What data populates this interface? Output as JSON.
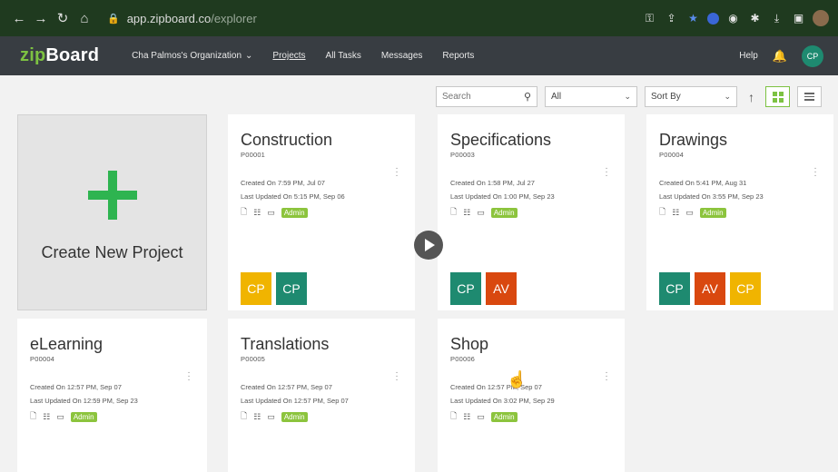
{
  "browser": {
    "url_host": "app.zipboard.co",
    "url_path": "/explorer"
  },
  "app": {
    "logo_zip": "zip",
    "logo_board": "Board",
    "org": "Cha Palmos's Organization",
    "nav": [
      "Projects",
      "All Tasks",
      "Messages",
      "Reports"
    ],
    "help": "Help",
    "user_initials": "CP"
  },
  "toolbar": {
    "search_placeholder": "Search",
    "filter_value": "All",
    "sort_value": "Sort By"
  },
  "create_card": {
    "label": "Create New Project"
  },
  "role_label": "Admin",
  "colors": {
    "brand_green": "#7dc242",
    "member_yellow": "#f0b400",
    "member_teal": "#1e8a70",
    "member_orange": "#d9480f"
  },
  "projects": [
    {
      "title": "Construction",
      "code": "P00001",
      "created": "Created On 7:59 PM, Jul 07",
      "updated": "Last Updated On 5:15 PM, Sep 06",
      "members": [
        {
          "initials": "CP",
          "color": "#f0b400"
        },
        {
          "initials": "CP",
          "color": "#1e8a70"
        }
      ]
    },
    {
      "title": "Specifications",
      "code": "P00003",
      "created": "Created On 1:58 PM, Jul 27",
      "updated": "Last Updated On 1:00 PM, Sep 23",
      "members": [
        {
          "initials": "CP",
          "color": "#1e8a70"
        },
        {
          "initials": "AV",
          "color": "#d9480f"
        }
      ]
    },
    {
      "title": "Drawings",
      "code": "P00004",
      "created": "Created On 5:41 PM, Aug 31",
      "updated": "Last Updated On 3:55 PM, Sep 23",
      "members": [
        {
          "initials": "CP",
          "color": "#1e8a70"
        },
        {
          "initials": "AV",
          "color": "#d9480f"
        },
        {
          "initials": "CP",
          "color": "#f0b400"
        }
      ]
    },
    {
      "title": "eLearning",
      "code": "P00004",
      "created": "Created On 12:57 PM, Sep 07",
      "updated": "Last Updated On 12:59 PM, Sep 23",
      "members": []
    },
    {
      "title": "Translations",
      "code": "P00005",
      "created": "Created On 12:57 PM, Sep 07",
      "updated": "Last Updated On 12:57 PM, Sep 07",
      "members": []
    },
    {
      "title": "Shop",
      "code": "P00006",
      "created": "Created On 12:57 PM, Sep 07",
      "updated": "Last Updated On 3:02 PM, Sep 29",
      "members": []
    }
  ]
}
